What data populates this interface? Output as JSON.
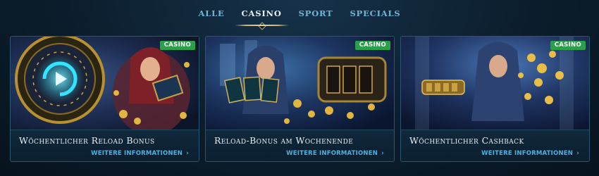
{
  "nav": {
    "tabs": [
      {
        "label": "ALLE",
        "active": false
      },
      {
        "label": "CASINO",
        "active": true
      },
      {
        "label": "SPORT",
        "active": false
      },
      {
        "label": "SPECIALS",
        "active": false
      }
    ]
  },
  "cards": [
    {
      "badge": "CASINO",
      "title": "Wöchentlicher Reload Bonus",
      "link": "WEITERE INFORMATIONEN",
      "chevron": "›"
    },
    {
      "badge": "CASINO",
      "title": "Reload-Bonus am Wochenende",
      "link": "WEITERE INFORMATIONEN",
      "chevron": "›"
    },
    {
      "badge": "CASINO",
      "title": "Wöchentlicher Cashback",
      "link": "WEITERE INFORMATIONEN",
      "chevron": "›"
    }
  ],
  "colors": {
    "background": "#0b1d2c",
    "tab_text": "#6fb6d6",
    "tab_active": "#e7eef2",
    "accent_gold": "#c9b072",
    "badge_green": "#2aa04a",
    "link_blue": "#4fb0de"
  }
}
